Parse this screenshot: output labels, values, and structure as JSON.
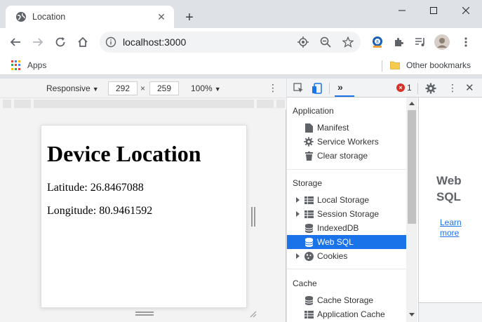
{
  "tab": {
    "title": "Location"
  },
  "omnibox": {
    "url": "localhost:3000"
  },
  "bookmarks": {
    "apps_label": "Apps",
    "other_label": "Other bookmarks"
  },
  "device_toolbar": {
    "device": "Responsive",
    "width": "292",
    "height": "259",
    "zoom": "100%",
    "separator": "×"
  },
  "page": {
    "heading": "Device Location",
    "latitude": "Latitude: 26.8467088",
    "longitude": "Longitude: 80.9461592"
  },
  "devtools": {
    "more_tabs": "»",
    "error_count": "1",
    "sections": [
      {
        "title": "Application",
        "items": [
          "Manifest",
          "Service Workers",
          "Clear storage"
        ]
      },
      {
        "title": "Storage",
        "items": [
          "Local Storage",
          "Session Storage",
          "IndexedDB",
          "Web SQL",
          "Cookies"
        ]
      },
      {
        "title": "Cache",
        "items": [
          "Cache Storage",
          "Application Cache"
        ]
      }
    ],
    "selected_item": "Web SQL",
    "websql_panel": {
      "title": "Web SQL",
      "learn_more": "Learn more"
    }
  },
  "colors": {
    "accent": "#1a73e8",
    "error": "#d93025",
    "tabstrip": "#dee1e6"
  }
}
